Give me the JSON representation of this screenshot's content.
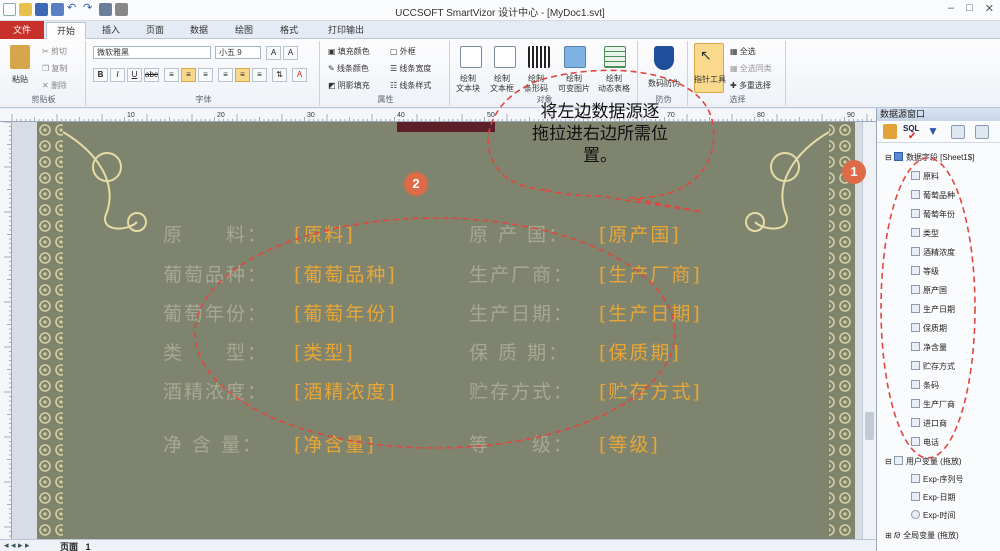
{
  "window": {
    "title": "UCCSOFT SmartVizor 设计中心 - [MyDoc1.svt]",
    "controls": [
      "–",
      "□",
      "✕"
    ]
  },
  "tabs": {
    "file": "文件",
    "items": [
      "开始",
      "插入",
      "页面",
      "数据",
      "绘图",
      "格式",
      "打印输出"
    ]
  },
  "ribbon": {
    "clipboard": {
      "paste": "粘贴",
      "cut": "剪切",
      "copy": "复制",
      "delete": "删除",
      "group": "剪贴板"
    },
    "font": {
      "family": "微软雅黑",
      "size": "小五 9",
      "group": "字体"
    },
    "attributes": {
      "fill": "填充颜色",
      "line": "线条颜色",
      "shadow": "阴影填充",
      "frame": "外框",
      "line_width": "线条宽度",
      "line_style": "线条样式",
      "group": "属性"
    },
    "draw": {
      "text_block": "绘制\n文本块",
      "text_frame": "绘制\n文本框",
      "barcode": "绘制\n条形码",
      "image": "绘制\n可变图片",
      "table": "绘制\n动态表格",
      "anti_fake": "数码防伪",
      "group_a": "对象",
      "group_b": "防伪"
    },
    "select": {
      "pointer": "指针工具",
      "all": "全选",
      "all_same": "全选同类",
      "multi": "多重选择",
      "group": "选择"
    }
  },
  "ruler": {
    "marks": [
      "10",
      "20",
      "30",
      "40",
      "50",
      "60",
      "70",
      "80",
      "90"
    ]
  },
  "label": {
    "rows": [
      {
        "label": "原　　料：",
        "field": "[原料]",
        "label2": "原 产 国：",
        "field2": "[原产国]"
      },
      {
        "label": "葡萄品种：",
        "field": "[葡萄品种]",
        "label2": "生产厂商：",
        "field2": "[生产厂商]"
      },
      {
        "label": "葡萄年份：",
        "field": "[葡萄年份]",
        "label2": "生产日期：",
        "field2": "[生产日期]"
      },
      {
        "label": "类　　型：",
        "field": "[类型]",
        "label2": "保 质 期：",
        "field2": "[保质期]"
      },
      {
        "label": "酒精浓度：",
        "field": "[酒精浓度]",
        "label2": "贮存方式：",
        "field2": "[贮存方式]"
      },
      {
        "label": "净 含 量：",
        "field": "[净含量]",
        "label2": "等　　级：",
        "field2": "[等级]"
      }
    ]
  },
  "annotations": {
    "callout": "将左边数据源逐\n拖拉进右边所需位\n置。",
    "badge1": "1",
    "badge2": "2"
  },
  "panel": {
    "title": "数据源窗口",
    "root": "数据字段 [Sheet1$]",
    "fields": [
      "原料",
      "葡萄品种",
      "葡萄年份",
      "类型",
      "酒精浓度",
      "等级",
      "原产国",
      "生产日期",
      "保质期",
      "净含量",
      "贮存方式",
      "条码",
      "生产厂商",
      "进口商",
      "电话"
    ],
    "user_vars": "用户变量 (拖放)",
    "user_var_items": [
      "Exp-序列号",
      "Exp-日期",
      "Exp-时间"
    ],
    "global_vars": "全局变量 (拖放)"
  },
  "bottom": {
    "page_label": "页面",
    "page_num": "1"
  },
  "colors": {
    "label_bg": "#7f846f",
    "label_text": "#a7a892",
    "field_text": "#e8a636",
    "annotation": "#e0473f",
    "badge": "#de6a48"
  }
}
